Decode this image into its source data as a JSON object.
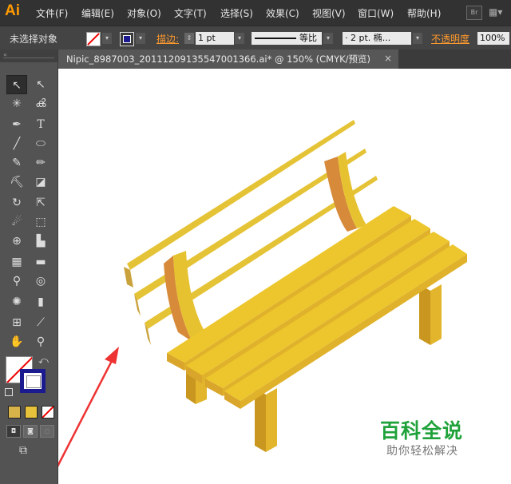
{
  "app": {
    "logo": "Ai"
  },
  "menu": {
    "items": [
      {
        "label": "文件(F)"
      },
      {
        "label": "编辑(E)"
      },
      {
        "label": "对象(O)"
      },
      {
        "label": "文字(T)"
      },
      {
        "label": "选择(S)"
      },
      {
        "label": "效果(C)"
      },
      {
        "label": "视图(V)"
      },
      {
        "label": "窗口(W)"
      },
      {
        "label": "帮助(H)"
      }
    ],
    "bridge_label": "Br"
  },
  "control_bar": {
    "selection_status": "未选择对象",
    "stroke_label": "描边:",
    "stroke_weight": "1 pt",
    "stroke_profile": "等比",
    "brush": "· 2 pt. 椭...",
    "opacity_label": "不透明度",
    "opacity_value": "100%"
  },
  "document": {
    "tab_title": "Nipic_8987003_20111209135547001366.ai* @ 150% (CMYK/预览)",
    "close_glyph": "×"
  },
  "toolbox": {
    "tools": [
      {
        "name": "selection-tool",
        "glyph": "▲"
      },
      {
        "name": "direct-selection-tool",
        "glyph": "△"
      },
      {
        "name": "magic-wand-tool",
        "glyph": "✦"
      },
      {
        "name": "lasso-tool",
        "glyph": "ʘ"
      },
      {
        "name": "pen-tool",
        "glyph": "✒"
      },
      {
        "name": "type-tool",
        "glyph": "T"
      },
      {
        "name": "line-tool",
        "glyph": "╱"
      },
      {
        "name": "ellipse-tool",
        "glyph": "◯"
      },
      {
        "name": "paintbrush-tool",
        "glyph": "✎"
      },
      {
        "name": "pencil-tool",
        "glyph": "✏"
      },
      {
        "name": "blob-brush-tool",
        "glyph": "◢"
      },
      {
        "name": "eraser-tool",
        "glyph": "◩"
      },
      {
        "name": "rotate-tool",
        "glyph": "↻"
      },
      {
        "name": "scale-tool",
        "glyph": "⇲"
      },
      {
        "name": "warp-tool",
        "glyph": "≈"
      },
      {
        "name": "free-transform-tool",
        "glyph": "⬚"
      },
      {
        "name": "shape-builder-tool",
        "glyph": "⊕"
      },
      {
        "name": "graph-tool",
        "glyph": "▥"
      },
      {
        "name": "mesh-tool",
        "glyph": "▦"
      },
      {
        "name": "gradient-tool",
        "glyph": "▭"
      },
      {
        "name": "eyedropper-tool",
        "glyph": "💧"
      },
      {
        "name": "blend-tool",
        "glyph": "◎"
      },
      {
        "name": "symbol-sprayer-tool",
        "glyph": "✺"
      },
      {
        "name": "column-graph-tool",
        "glyph": "▮"
      },
      {
        "name": "artboard-tool",
        "glyph": "⊞"
      },
      {
        "name": "slice-tool",
        "glyph": "⟋"
      },
      {
        "name": "hand-tool",
        "glyph": "✋"
      },
      {
        "name": "zoom-tool",
        "glyph": "🔍"
      }
    ],
    "colors": {
      "stroke": "#1b1b8f",
      "swatch_1": "#d8b34a",
      "swatch_2": "#e8c23a"
    }
  },
  "watermark": {
    "main": "百科全说",
    "sub": "助你轻松解决"
  },
  "colors": {
    "bench_top": "#e9c22b",
    "bench_side": "#d9a52a",
    "bench_dark": "#c9971f",
    "arrow": "#ee3333",
    "watermark_green": "#1fa23a"
  }
}
